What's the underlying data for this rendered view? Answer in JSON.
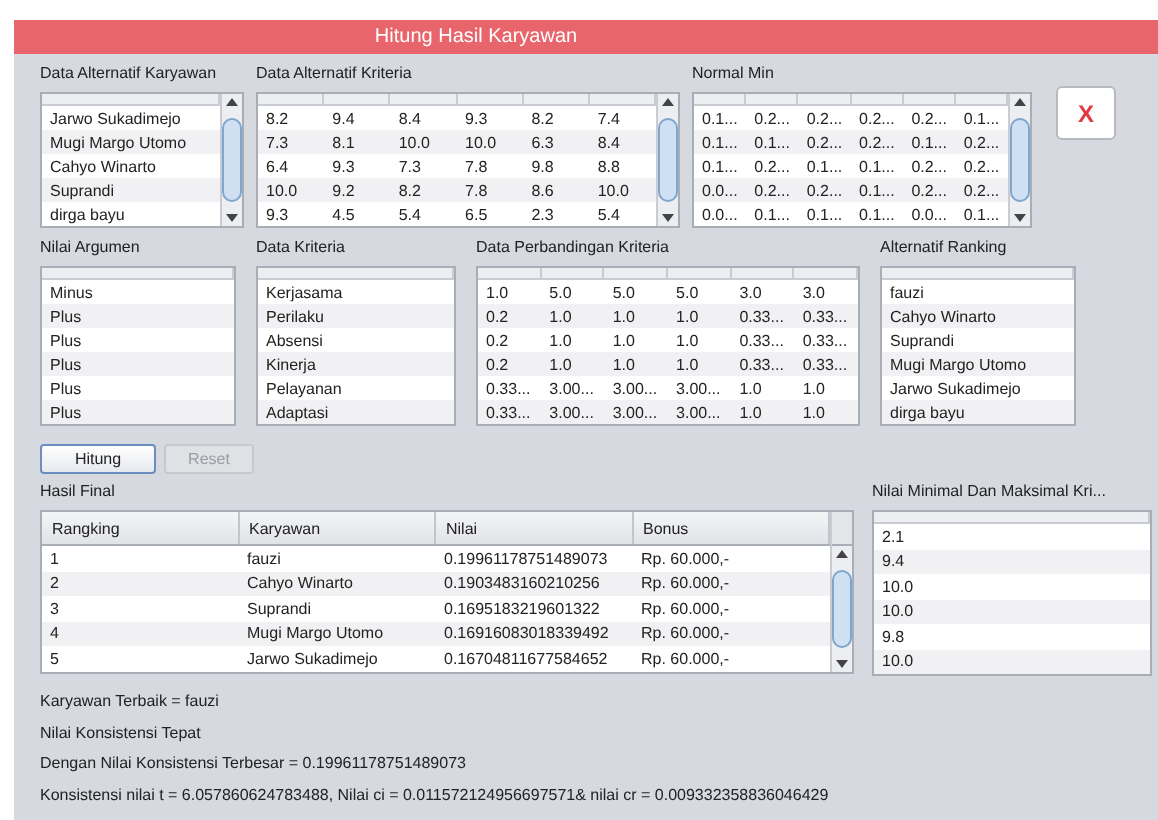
{
  "window": {
    "title": "Hitung Hasil Karyawan"
  },
  "close_button": {
    "label": "X"
  },
  "data_alternatif_karyawan": {
    "label": "Data Alternatif Karyawan",
    "rows": [
      "Jarwo Sukadimejo",
      "Mugi Margo Utomo",
      "Cahyo Winarto",
      "Suprandi",
      "dirga bayu"
    ]
  },
  "data_alternatif_kriteria": {
    "label": "Data Alternatif Kriteria",
    "rows": [
      [
        "8.2",
        "9.4",
        "8.4",
        "9.3",
        "8.2",
        "7.4"
      ],
      [
        "7.3",
        "8.1",
        "10.0",
        "10.0",
        "6.3",
        "8.4"
      ],
      [
        "6.4",
        "9.3",
        "7.3",
        "7.8",
        "9.8",
        "8.8"
      ],
      [
        "10.0",
        "9.2",
        "8.2",
        "7.8",
        "8.6",
        "10.0"
      ],
      [
        "9.3",
        "4.5",
        "5.4",
        "6.5",
        "2.3",
        "5.4"
      ]
    ]
  },
  "normal_min": {
    "label": "Normal Min",
    "rows": [
      [
        "0.1...",
        "0.2...",
        "0.2...",
        "0.2...",
        "0.2...",
        "0.1..."
      ],
      [
        "0.1...",
        "0.1...",
        "0.2...",
        "0.2...",
        "0.1...",
        "0.2..."
      ],
      [
        "0.1...",
        "0.2...",
        "0.1...",
        "0.1...",
        "0.2...",
        "0.2..."
      ],
      [
        "0.0...",
        "0.2...",
        "0.2...",
        "0.1...",
        "0.2...",
        "0.2..."
      ],
      [
        "0.0...",
        "0.1...",
        "0.1...",
        "0.1...",
        "0.0...",
        "0.1..."
      ]
    ]
  },
  "nilai_argumen": {
    "label": "Nilai Argumen",
    "rows": [
      "Minus",
      "Plus",
      "Plus",
      "Plus",
      "Plus",
      "Plus"
    ]
  },
  "data_kriteria": {
    "label": "Data Kriteria",
    "rows": [
      "Kerjasama",
      "Perilaku",
      "Absensi",
      "Kinerja",
      "Pelayanan",
      "Adaptasi"
    ]
  },
  "data_perbandingan_kriteria": {
    "label": "Data Perbandingan Kriteria",
    "rows": [
      [
        "1.0",
        "5.0",
        "5.0",
        "5.0",
        "3.0",
        "3.0"
      ],
      [
        "0.2",
        "1.0",
        "1.0",
        "1.0",
        "0.33...",
        "0.33..."
      ],
      [
        "0.2",
        "1.0",
        "1.0",
        "1.0",
        "0.33...",
        "0.33..."
      ],
      [
        "0.2",
        "1.0",
        "1.0",
        "1.0",
        "0.33...",
        "0.33..."
      ],
      [
        "0.33...",
        "3.00...",
        "3.00...",
        "3.00...",
        "1.0",
        "1.0"
      ],
      [
        "0.33...",
        "3.00...",
        "3.00...",
        "3.00...",
        "1.0",
        "1.0"
      ]
    ]
  },
  "alternatif_ranking": {
    "label": "Alternatif Ranking",
    "rows": [
      "fauzi",
      "Cahyo Winarto",
      "Suprandi",
      "Mugi Margo Utomo",
      "Jarwo Sukadimejo",
      "dirga bayu"
    ]
  },
  "buttons": [
    {
      "label": "Hitung",
      "disabled": false
    },
    {
      "label": "Reset",
      "disabled": true
    }
  ],
  "hasil_final": {
    "label": "Hasil Final",
    "columns": [
      "Rangking",
      "Karyawan",
      "Nilai",
      "Bonus"
    ],
    "rows": [
      [
        "1",
        "fauzi",
        "0.19961178751489073",
        "Rp. 60.000,-"
      ],
      [
        "2",
        "Cahyo Winarto",
        "0.1903483160210256",
        "Rp. 60.000,-"
      ],
      [
        "3",
        "Suprandi",
        "0.1695183219601322",
        "Rp. 60.000,-"
      ],
      [
        "4",
        "Mugi Margo Utomo",
        "0.16916083018339492",
        "Rp. 60.000,-"
      ],
      [
        "5",
        "Jarwo Sukadimejo",
        "0.16704811677584652",
        "Rp. 60.000,-"
      ]
    ]
  },
  "nilai_minimal_maksimal": {
    "label": "Nilai Minimal Dan Maksimal Kri...",
    "rows": [
      "2.1",
      "9.4",
      "10.0",
      "10.0",
      "9.8",
      "10.0"
    ]
  },
  "results": [
    "Karyawan Terbaik = fauzi",
    "Nilai Konsistensi Tepat",
    "Dengan Nilai Konsistensi Terbesar = 0.19961178751489073",
    "Konsistensi nilai t = 6.057860624783488, Nilai ci = 0.011572124956697571& nilai  cr = 0.009332358836046429"
  ]
}
